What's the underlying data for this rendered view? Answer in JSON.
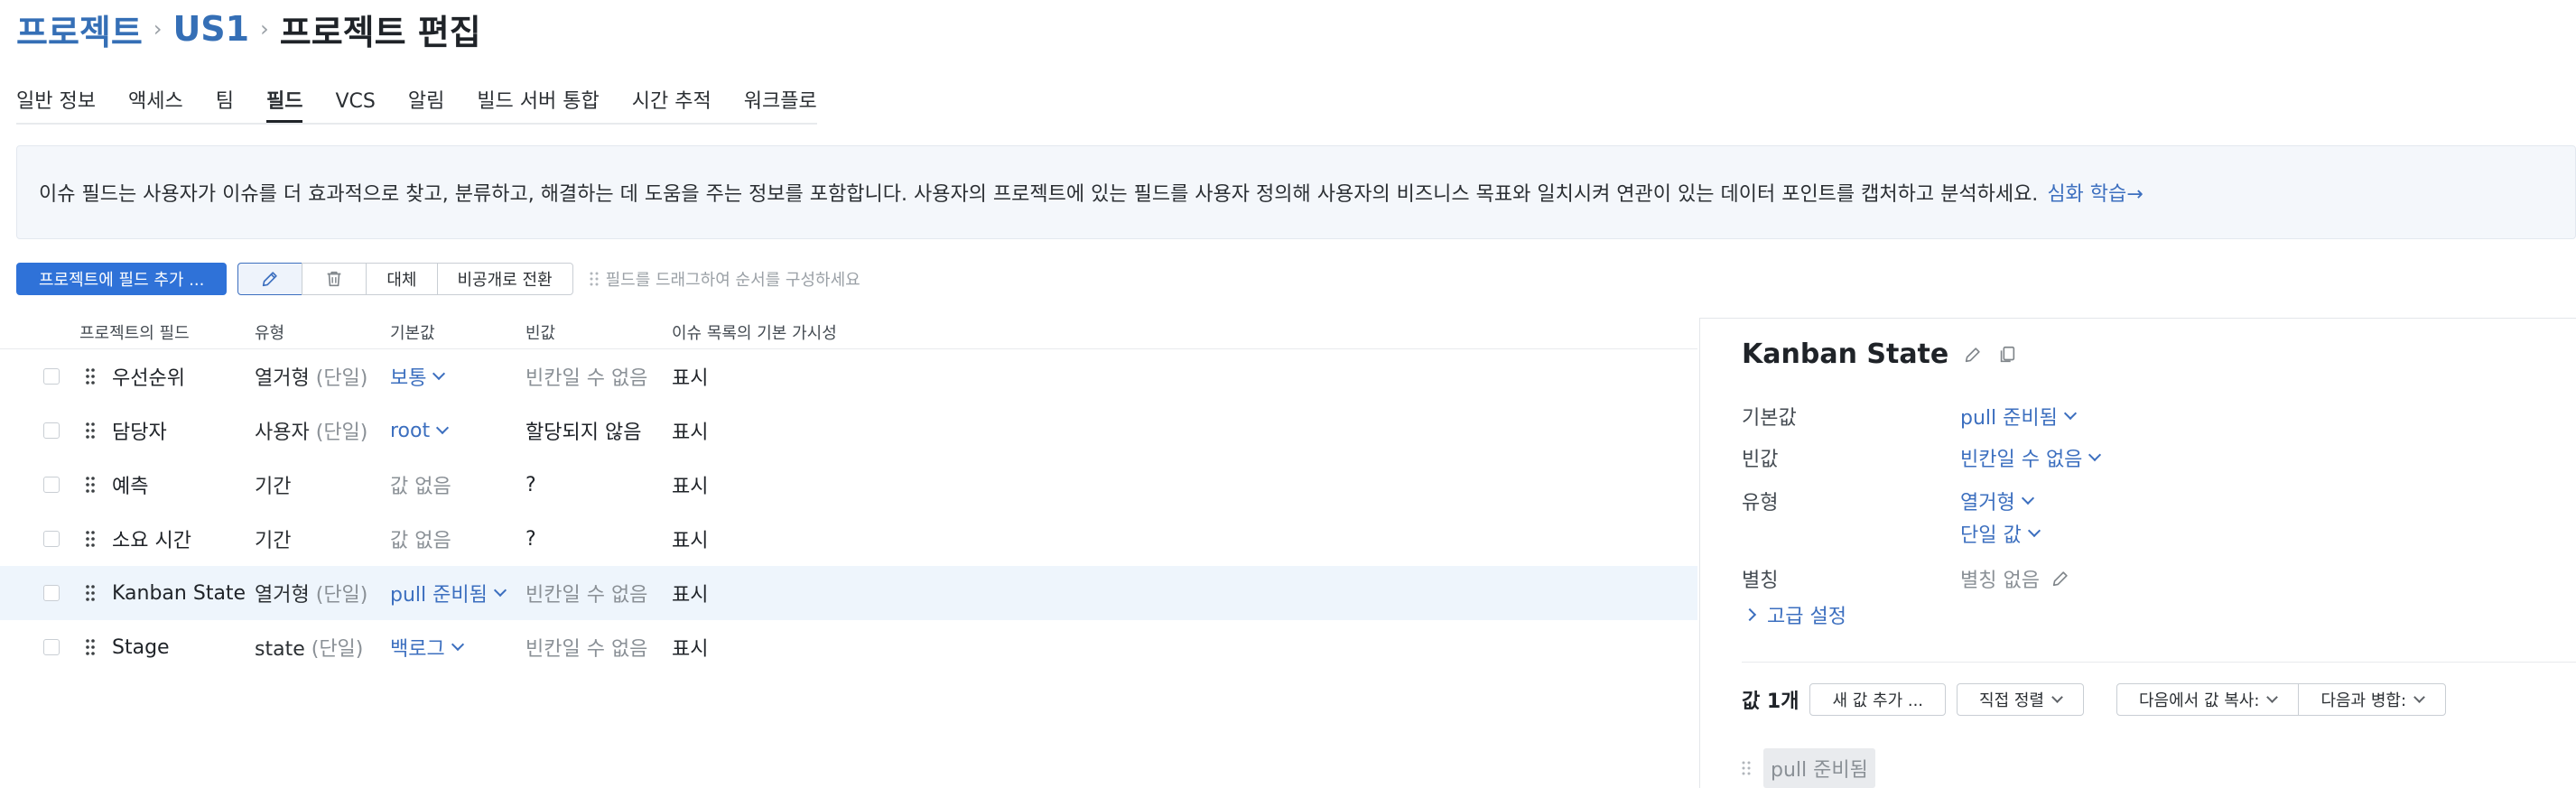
{
  "breadcrumb": {
    "projects": "프로젝트",
    "project": "US1",
    "title": "프로젝트 편집"
  },
  "tabs": [
    {
      "label": "일반 정보"
    },
    {
      "label": "액세스"
    },
    {
      "label": "팀"
    },
    {
      "label": "필드",
      "active": true
    },
    {
      "label": "VCS"
    },
    {
      "label": "알림"
    },
    {
      "label": "빌드 서버 통합"
    },
    {
      "label": "시간 추적"
    },
    {
      "label": "워크플로"
    }
  ],
  "info": {
    "text": "이슈 필드는 사용자가 이슈를 더 효과적으로 찾고, 분류하고, 해결하는 데 도움을 주는 정보를 포함합니다. 사용자의 프로젝트에 있는 필드를 사용자 정의해 사용자의 비즈니스 목표와 일치시켜 연관이 있는 데이터 포인트를 캡처하고 분석하세요.",
    "link": "심화 학습→"
  },
  "toolbar": {
    "add_field": "프로젝트에 필드 추가 ...",
    "replace": "대체",
    "make_private": "비공개로 전환",
    "hint": "필드를 드래그하여 순서를 구성하세요",
    "edit_icon": "pencil-icon",
    "delete_icon": "trash-icon"
  },
  "table": {
    "headers": {
      "field": "프로젝트의 필드",
      "type": "유형",
      "default": "기본값",
      "empty": "빈값",
      "visibility": "이슈 목록의 기본 가시성"
    },
    "rows": [
      {
        "name": "우선순위",
        "type": "열거형",
        "type_sub": "(단일)",
        "default": "보통",
        "default_link": true,
        "empty": "빈칸일 수 없음",
        "empty_muted": true,
        "visibility": "표시"
      },
      {
        "name": "담당자",
        "type": "사용자",
        "type_sub": "(단일)",
        "default": "root",
        "default_link": true,
        "empty": "할당되지 않음",
        "empty_muted": false,
        "visibility": "표시"
      },
      {
        "name": "예측",
        "type": "기간",
        "type_sub": "",
        "default": "값 없음",
        "default_link": false,
        "empty": "?",
        "empty_muted": false,
        "visibility": "표시"
      },
      {
        "name": "소요 시간",
        "type": "기간",
        "type_sub": "",
        "default": "값 없음",
        "default_link": false,
        "empty": "?",
        "empty_muted": false,
        "visibility": "표시"
      },
      {
        "name": "Kanban State",
        "type": "열거형",
        "type_sub": "(단일)",
        "default": "pull 준비됨",
        "default_link": true,
        "empty": "빈칸일 수 없음",
        "empty_muted": true,
        "visibility": "표시",
        "selected": true
      },
      {
        "name": "Stage",
        "type": "state",
        "type_sub": "(단일)",
        "default": "백로그",
        "default_link": true,
        "empty": "빈칸일 수 없음",
        "empty_muted": true,
        "visibility": "표시"
      }
    ]
  },
  "panel": {
    "title": "Kanban State",
    "default_label": "기본값",
    "default_value": "pull 준비됨",
    "empty_label": "빈값",
    "empty_value": "빈칸일 수 없음",
    "type_label": "유형",
    "type_value": "열거형",
    "type_value2": "단일 값",
    "alias_label": "별칭",
    "alias_value": "별칭 없음",
    "advanced": "고급 설정",
    "values_count": "값 1개",
    "add_value": "새 값 추가 ...",
    "sort": "직접 정렬",
    "copy_from": "다음에서 값 복사:",
    "merge_with": "다음과 병합:",
    "value_items": [
      "pull 준비됨"
    ]
  },
  "colors": {
    "accent": "#2f72d8",
    "link": "#3c6fbf",
    "selected_row": "#eef5fc"
  }
}
